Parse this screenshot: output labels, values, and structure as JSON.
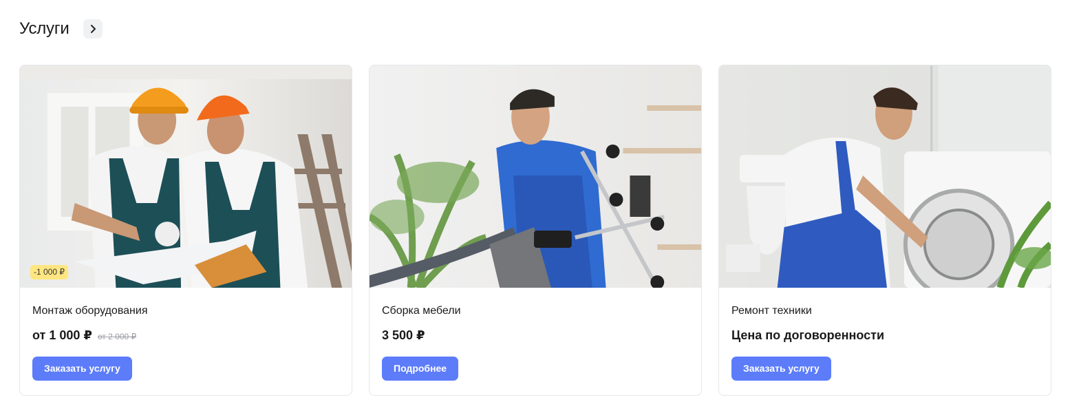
{
  "section": {
    "title": "Услуги"
  },
  "cards": [
    {
      "name": "Монтаж оборудования",
      "price": "от 1 000 ₽",
      "old_price": "от 2 000 ₽",
      "badge": "-1 000 ₽",
      "button": "Заказать услугу"
    },
    {
      "name": "Сборка мебели",
      "price": "3 500 ₽",
      "button": "Подробнее"
    },
    {
      "name": "Ремонт техники",
      "price": "Цена по договоренности",
      "button": "Заказать услугу"
    }
  ],
  "colors": {
    "accent": "#5c7cfa",
    "badge": "#ffe680",
    "border": "#e6e7ea"
  },
  "icons": {
    "header_arrow": "chevron-right-icon"
  }
}
